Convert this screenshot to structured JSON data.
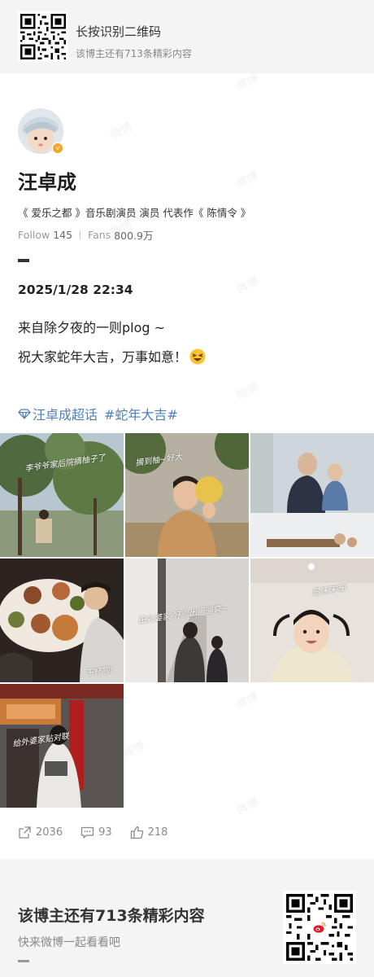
{
  "banner": {
    "title": "长按识别二维码",
    "subtitle": "该博主还有713条精彩内容"
  },
  "profile": {
    "name": "汪卓成",
    "bio": "《 爱乐之都 》音乐剧演员  演员 代表作《 陈情令 》",
    "follow_label": "Follow",
    "follow_count": "145",
    "fans_label": "Fans",
    "fans_count": "800.9万",
    "verified_color": "#f5a623"
  },
  "post": {
    "date": "2025/1/28 22:34",
    "line1": "来自除夕夜的一则plog ~",
    "line2": "祝大家蛇年大吉，万事如意！",
    "emoji": "laughing-face-emoji",
    "tags": [
      "汪卓成超话",
      "#蛇年大吉#"
    ],
    "tag_color": "#4e7fb8",
    "photo_captions": [
      {
        "id": "p1",
        "text": "李爷爷家后院摘柚子了"
      },
      {
        "id": "p2",
        "text": "摘到柚~好大"
      },
      {
        "id": "p6",
        "text": "田外婆家  好少出门遛弯~"
      },
      {
        "id": "p7",
        "text": "是沫沫呀!"
      },
      {
        "id": "p5",
        "text": "干杯啦!"
      },
      {
        "id": "p8",
        "text": "给外婆家贴对联"
      }
    ]
  },
  "actions": {
    "reposts": "2036",
    "comments": "93",
    "likes": "218"
  },
  "footer": {
    "title": "该博主还有713条精彩内容",
    "subtitle": "快来微博一起看看吧"
  },
  "watermark": "微博"
}
